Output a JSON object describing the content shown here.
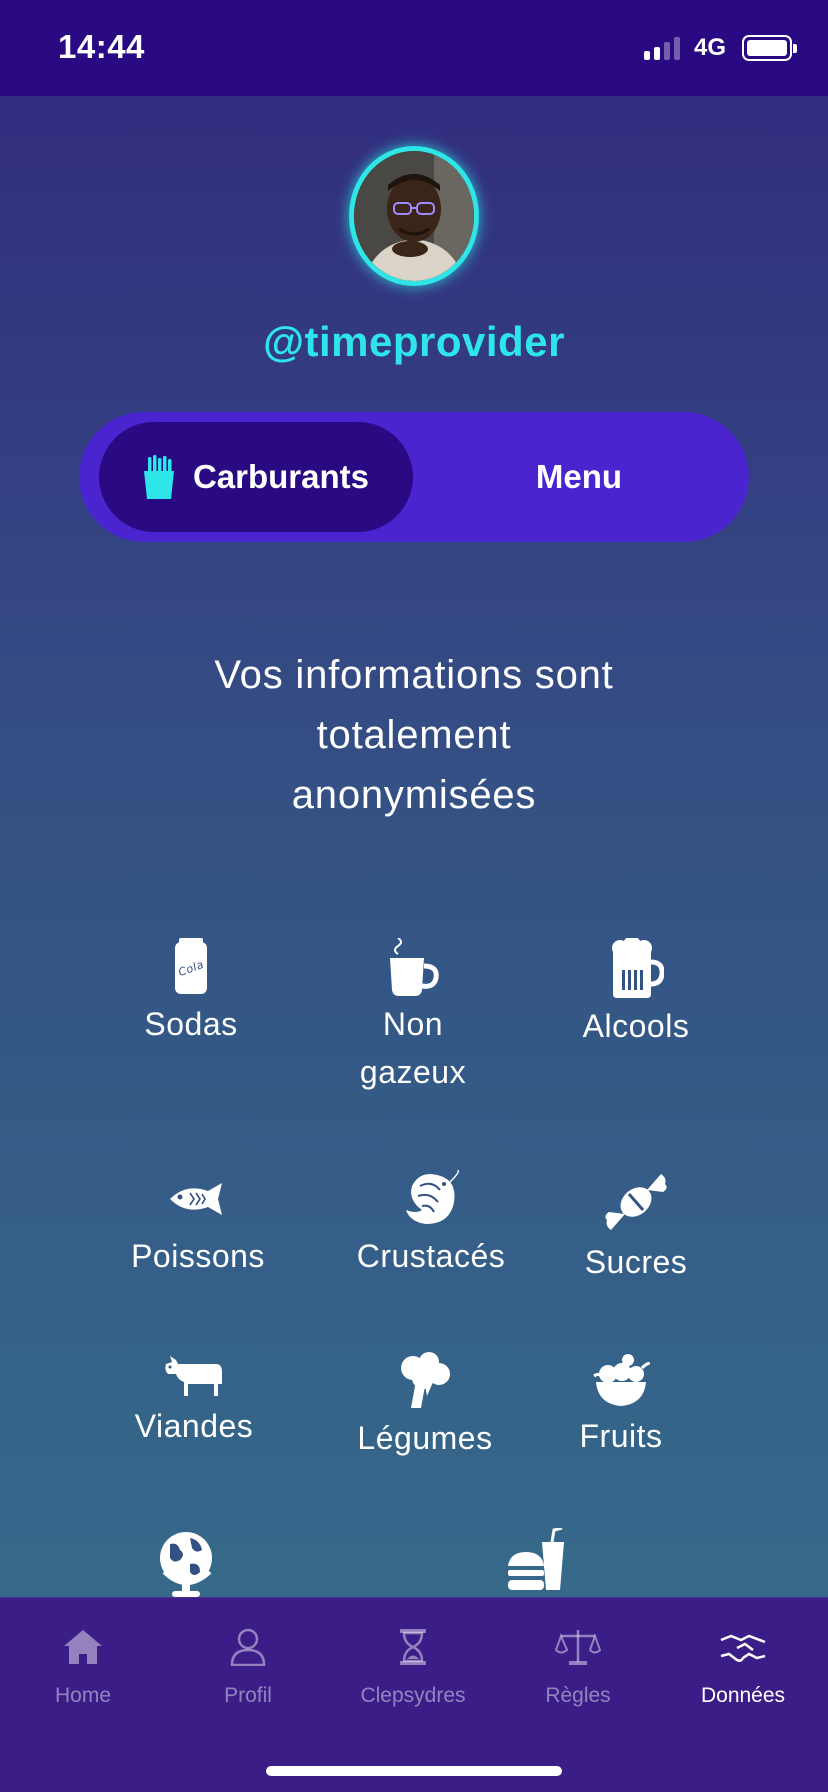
{
  "status": {
    "time": "14:44",
    "network": "4G"
  },
  "profile": {
    "username": "@timeprovider"
  },
  "segmented": {
    "active_label": "Carburants",
    "inactive_label": "Menu",
    "active_icon": "fries-icon"
  },
  "info": {
    "line1": "Vos informations sont",
    "line2": "totalement",
    "line3": "anonymisées"
  },
  "categories": [
    {
      "label": "Sodas",
      "icon": "soda-can-icon"
    },
    {
      "label_line1": "Non",
      "label_line2": "gazeux",
      "icon": "coffee-cup-icon"
    },
    {
      "label": "Alcools",
      "icon": "beer-mug-icon"
    },
    {
      "label": "Poissons",
      "icon": "fish-icon"
    },
    {
      "label": "Crustacés",
      "icon": "shrimp-icon"
    },
    {
      "label": "Sucres",
      "icon": "candy-icon"
    },
    {
      "label": "Viandes",
      "icon": "cow-icon"
    },
    {
      "label": "Légumes",
      "icon": "broccoli-icon"
    },
    {
      "label": "Fruits",
      "icon": "fruit-basket-icon"
    },
    {
      "icon": "globe-icon"
    },
    {
      "icon": "fast-food-icon"
    }
  ],
  "tabs": [
    {
      "label": "Home",
      "icon": "home-icon"
    },
    {
      "label": "Profil",
      "icon": "user-icon"
    },
    {
      "label": "Clepsydres",
      "icon": "hourglass-icon"
    },
    {
      "label": "Règles",
      "icon": "scales-icon"
    },
    {
      "label": "Données",
      "icon": "handshake-icon",
      "active": true
    }
  ],
  "colors": {
    "accent": "#2ee6ea",
    "segment_bg": "#4a25cf",
    "segment_active": "#2a0a82",
    "tabbar": "#3b1d88"
  }
}
